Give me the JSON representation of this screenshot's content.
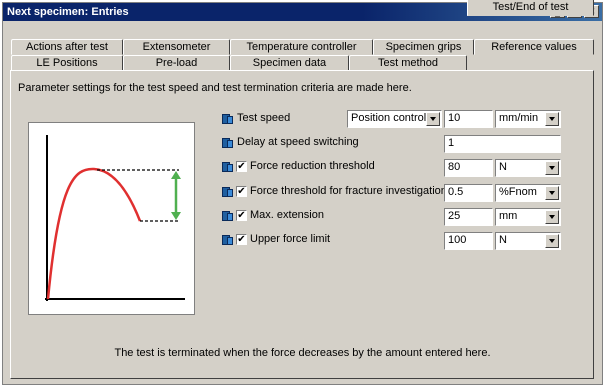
{
  "window": {
    "title": "Next specimen: Entries",
    "controls": [
      "_",
      "□",
      "×"
    ]
  },
  "tabs_back": [
    "Actions after test",
    "Extensometer",
    "Temperature controller",
    "Specimen grips",
    "Reference values"
  ],
  "tabs_front": [
    "LE Positions",
    "Pre-load",
    "Specimen data",
    "Test method",
    "Test/End of test"
  ],
  "active_tab": "Test/End of test",
  "description": "Parameter settings for the test speed and test termination criteria are made here.",
  "params": {
    "test_speed": {
      "label": "Test speed",
      "mode": "Position controlle",
      "value": "10",
      "unit": "mm/min"
    },
    "delay": {
      "label": "Delay at speed switching",
      "value": "1"
    },
    "force_reduction": {
      "label": "Force reduction threshold",
      "checked": true,
      "value": "80",
      "unit": "N"
    },
    "force_fracture": {
      "label": "Force threshold for fracture investigation",
      "checked": true,
      "value": "0.5",
      "unit": "%Fnom"
    },
    "max_extension": {
      "label": "Max. extension",
      "checked": true,
      "value": "25",
      "unit": "mm"
    },
    "upper_force": {
      "label": "Upper force limit",
      "checked": true,
      "value": "100",
      "unit": "N"
    }
  },
  "footer": "The test is terminated when the force decreases by the amount entered here.",
  "colors": {
    "curve": "#e03030",
    "arrow": "#50b050",
    "titlebar": "#0a246a"
  }
}
